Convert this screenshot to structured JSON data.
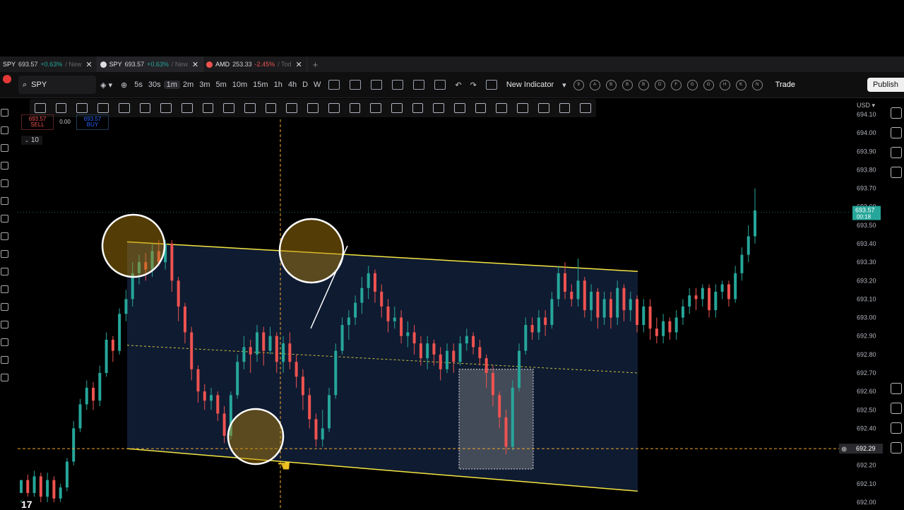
{
  "tabs": [
    {
      "symbol": "SPY",
      "price": "693.57",
      "change": "+0.63%",
      "extra": "/ New",
      "dir": "up",
      "active": false
    },
    {
      "symbol": "SPY",
      "price": "693.57",
      "change": "+0.63%",
      "extra": "/ New",
      "dir": "up",
      "active": true
    },
    {
      "symbol": "AMD",
      "price": "253.33",
      "change": "-2.45%",
      "extra": "/ Tod",
      "dir": "dn",
      "active": false
    }
  ],
  "toolbar": {
    "search_symbol": "SPY",
    "intervals": [
      "5s",
      "30s",
      "1m",
      "2m",
      "3m",
      "5m",
      "10m",
      "15m",
      "1h",
      "4h",
      "D",
      "W"
    ],
    "selected_interval": "1m",
    "indicator_label": "New Indicator",
    "alert_letters": [
      "9",
      "A",
      "B",
      "B",
      "B",
      "D",
      "F",
      "G",
      "G",
      "H",
      "K",
      "N"
    ],
    "trade_label": "Trade",
    "publish_label": "Publish"
  },
  "order": {
    "sell_price": "693.57",
    "sell_label": "SELL",
    "qty": "0.00",
    "buy_price": "693.57",
    "buy_label": "BUY",
    "qty_tag": "10"
  },
  "chart_data": {
    "type": "candlestick",
    "currency": "USD",
    "ylim": [
      692.0,
      694.1
    ],
    "yticks": [
      "694.10",
      "694.00",
      "693.90",
      "693.80",
      "693.70",
      "693.60",
      "693.50",
      "693.40",
      "693.30",
      "693.20",
      "693.10",
      "693.00",
      "692.90",
      "692.80",
      "692.70",
      "692.60",
      "692.50",
      "692.40",
      "692.30",
      "692.20",
      "692.10",
      "692.00"
    ],
    "last_price": "693.57",
    "last_price_timer": "00:18",
    "crosshair_price": "692.29",
    "candles": [
      [
        692.05,
        692.12,
        692.01,
        692.0
      ],
      [
        692.12,
        692.05,
        692.15,
        692.03
      ],
      [
        692.05,
        692.14,
        692.17,
        692.03
      ],
      [
        692.14,
        692.03,
        692.16,
        692.0
      ],
      [
        692.03,
        692.12,
        692.16,
        692.0
      ],
      [
        692.12,
        692.02,
        692.14,
        692.0
      ],
      [
        692.02,
        692.08,
        692.1,
        692.0
      ],
      [
        692.08,
        692.22,
        692.24,
        692.06
      ],
      [
        692.22,
        692.4,
        692.44,
        692.2
      ],
      [
        692.4,
        692.53,
        692.56,
        692.38
      ],
      [
        692.53,
        692.62,
        692.66,
        692.5
      ],
      [
        692.62,
        692.55,
        692.65,
        692.5
      ],
      [
        692.55,
        692.7,
        692.74,
        692.52
      ],
      [
        692.7,
        692.88,
        692.92,
        692.68
      ],
      [
        692.88,
        692.82,
        692.9,
        692.76
      ],
      [
        692.82,
        693.02,
        693.05,
        692.8
      ],
      [
        693.02,
        693.1,
        693.15,
        692.98
      ],
      [
        693.1,
        693.24,
        693.3,
        693.06
      ],
      [
        693.24,
        693.3,
        693.34,
        693.18
      ],
      [
        693.3,
        693.26,
        693.35,
        693.2
      ],
      [
        693.26,
        693.36,
        693.4,
        693.22
      ],
      [
        693.36,
        693.3,
        693.42,
        693.28
      ],
      [
        693.3,
        693.4,
        693.42,
        693.26
      ],
      [
        693.4,
        693.2,
        693.42,
        693.14
      ],
      [
        693.2,
        693.06,
        693.22,
        692.98
      ],
      [
        693.06,
        692.92,
        693.08,
        692.86
      ],
      [
        692.92,
        692.72,
        692.95,
        692.66
      ],
      [
        692.72,
        692.6,
        692.74,
        692.54
      ],
      [
        692.6,
        692.55,
        692.64,
        692.5
      ],
      [
        692.55,
        692.58,
        692.62,
        692.5
      ],
      [
        692.58,
        692.48,
        692.6,
        692.44
      ],
      [
        692.48,
        692.36,
        692.52,
        692.32
      ],
      [
        692.36,
        692.58,
        692.6,
        692.34
      ],
      [
        692.58,
        692.76,
        692.8,
        692.56
      ],
      [
        692.76,
        692.84,
        692.9,
        692.72
      ],
      [
        692.84,
        692.8,
        692.88,
        692.7
      ],
      [
        692.8,
        692.92,
        692.96,
        692.76
      ],
      [
        692.92,
        692.82,
        692.95,
        692.74
      ],
      [
        692.82,
        692.9,
        692.95,
        692.8
      ],
      [
        692.9,
        692.76,
        692.92,
        692.7
      ],
      [
        692.76,
        692.86,
        692.9,
        692.7
      ],
      [
        692.86,
        692.76,
        692.92,
        692.72
      ],
      [
        692.76,
        692.68,
        692.8,
        692.62
      ],
      [
        692.68,
        692.58,
        692.72,
        692.5
      ],
      [
        692.58,
        692.45,
        692.62,
        692.4
      ],
      [
        692.45,
        692.34,
        692.48,
        692.3
      ],
      [
        692.34,
        692.4,
        692.5,
        692.3
      ],
      [
        692.4,
        692.58,
        692.62,
        692.38
      ],
      [
        692.58,
        692.82,
        692.86,
        692.56
      ],
      [
        692.82,
        692.96,
        693.0,
        692.8
      ],
      [
        692.96,
        693.0,
        693.04,
        692.88
      ],
      [
        693.0,
        693.08,
        693.12,
        692.96
      ],
      [
        693.08,
        693.16,
        693.22,
        693.02
      ],
      [
        693.16,
        693.24,
        693.28,
        693.1
      ],
      [
        693.24,
        693.14,
        693.26,
        693.08
      ],
      [
        693.14,
        693.06,
        693.18,
        693.0
      ],
      [
        693.06,
        692.98,
        693.1,
        692.92
      ],
      [
        692.98,
        693.0,
        693.06,
        692.94
      ],
      [
        693.0,
        692.9,
        693.04,
        692.86
      ],
      [
        692.9,
        692.92,
        692.98,
        692.84
      ],
      [
        692.92,
        692.86,
        692.96,
        692.8
      ],
      [
        692.86,
        692.78,
        692.9,
        692.74
      ],
      [
        692.78,
        692.86,
        692.9,
        692.72
      ],
      [
        692.86,
        692.8,
        692.88,
        692.74
      ],
      [
        692.8,
        692.72,
        692.84,
        692.66
      ],
      [
        692.72,
        692.82,
        692.86,
        692.7
      ],
      [
        692.82,
        692.76,
        692.86,
        692.7
      ],
      [
        692.76,
        692.86,
        692.9,
        692.74
      ],
      [
        692.86,
        692.9,
        692.94,
        692.82
      ],
      [
        692.9,
        692.84,
        692.92,
        692.8
      ],
      [
        692.84,
        692.78,
        692.88,
        692.74
      ],
      [
        692.78,
        692.7,
        692.8,
        692.62
      ],
      [
        692.7,
        692.58,
        692.74,
        692.52
      ],
      [
        692.58,
        692.46,
        692.6,
        692.4
      ],
      [
        692.46,
        692.3,
        692.5,
        692.26
      ],
      [
        692.3,
        692.62,
        692.66,
        692.28
      ],
      [
        692.62,
        692.82,
        692.86,
        692.6
      ],
      [
        692.82,
        692.96,
        693.0,
        692.8
      ],
      [
        692.96,
        692.92,
        693.0,
        692.88
      ],
      [
        692.92,
        693.0,
        693.04,
        692.88
      ],
      [
        693.0,
        692.96,
        693.04,
        692.9
      ],
      [
        692.96,
        693.1,
        693.14,
        692.94
      ],
      [
        693.1,
        693.24,
        693.28,
        693.06
      ],
      [
        693.24,
        693.14,
        693.3,
        693.1
      ],
      [
        693.14,
        693.1,
        693.18,
        693.06
      ],
      [
        693.1,
        693.2,
        693.32,
        693.06
      ],
      [
        693.2,
        693.04,
        693.22,
        693.0
      ],
      [
        693.04,
        693.14,
        693.18,
        692.98
      ],
      [
        693.14,
        693.0,
        693.16,
        692.94
      ],
      [
        693.0,
        693.1,
        693.14,
        692.96
      ],
      [
        693.1,
        693.0,
        693.14,
        692.94
      ],
      [
        693.0,
        693.16,
        693.2,
        692.96
      ],
      [
        693.16,
        693.04,
        693.18,
        692.98
      ],
      [
        693.04,
        693.1,
        693.14,
        692.98
      ],
      [
        693.1,
        692.96,
        693.12,
        692.92
      ],
      [
        692.96,
        693.06,
        693.1,
        692.92
      ],
      [
        693.06,
        692.94,
        693.1,
        692.88
      ],
      [
        692.94,
        692.9,
        693.0,
        692.86
      ],
      [
        692.9,
        692.98,
        693.02,
        692.86
      ],
      [
        692.98,
        692.92,
        693.0,
        692.88
      ],
      [
        692.92,
        693.0,
        693.04,
        692.88
      ],
      [
        693.0,
        693.06,
        693.1,
        692.96
      ],
      [
        693.06,
        693.12,
        693.16,
        693.02
      ],
      [
        693.12,
        693.1,
        693.16,
        693.04
      ],
      [
        693.1,
        693.16,
        693.18,
        693.06
      ],
      [
        693.16,
        693.04,
        693.18,
        693.0
      ],
      [
        693.04,
        693.14,
        693.18,
        693.0
      ],
      [
        693.14,
        693.18,
        693.2,
        693.1
      ],
      [
        693.18,
        693.1,
        693.2,
        693.06
      ],
      [
        693.1,
        693.24,
        693.28,
        693.08
      ],
      [
        693.24,
        693.34,
        693.38,
        693.2
      ],
      [
        693.34,
        693.44,
        693.5,
        693.3
      ],
      [
        693.44,
        693.58,
        693.7,
        693.4
      ]
    ],
    "channel": {
      "upper": [
        693.41,
        693.25
      ],
      "lower": [
        692.29,
        692.06
      ],
      "mid": [
        692.85,
        692.7
      ]
    },
    "highlight_box": [
      692.72,
      692.18
    ]
  }
}
